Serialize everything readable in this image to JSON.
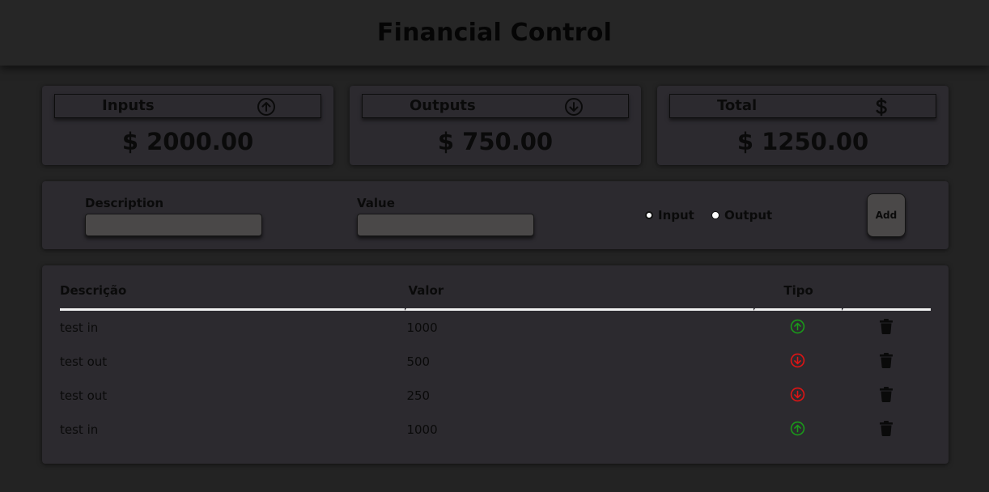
{
  "header": {
    "title": "Financial Control"
  },
  "summary": {
    "inputs": {
      "label": "Inputs",
      "amount": "$ 2000.00",
      "icon": "arrow-up-circle-icon"
    },
    "outputs": {
      "label": "Outputs",
      "amount": "$ 750.00",
      "icon": "arrow-down-circle-icon"
    },
    "total": {
      "label": "Total",
      "amount": "$ 1250.00",
      "icon": "dollar-icon"
    }
  },
  "form": {
    "description_label": "Description",
    "description_value": "",
    "value_label": "Value",
    "value_value": "",
    "radio_input_label": "Input",
    "radio_output_label": "Output",
    "selected_type": "Input",
    "add_label": "Add"
  },
  "table": {
    "columns": [
      "Descrição",
      "Valor",
      "Tipo",
      ""
    ],
    "rows": [
      {
        "description": "test in",
        "value": "1000",
        "type": "input"
      },
      {
        "description": "test out",
        "value": "500",
        "type": "output"
      },
      {
        "description": "test out",
        "value": "250",
        "type": "output"
      },
      {
        "description": "test in",
        "value": "1000",
        "type": "input"
      }
    ]
  },
  "colors": {
    "background": "#232323",
    "card": "#2c2a2f",
    "input_icon": "#1a9a1a",
    "output_icon": "#e01414"
  }
}
